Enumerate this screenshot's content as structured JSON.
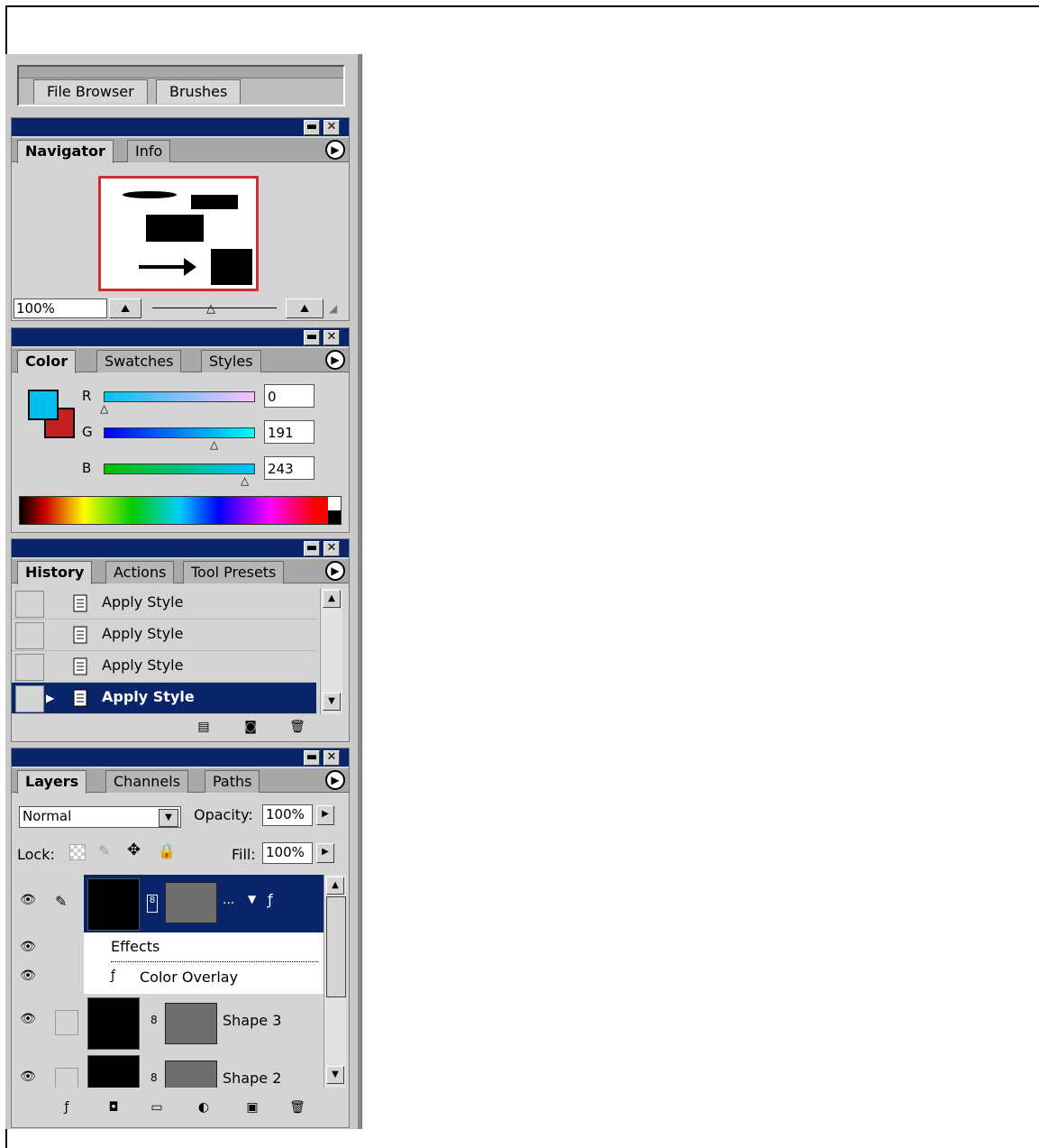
{
  "palette_well": {
    "tabs": [
      "File Browser",
      "Brushes"
    ]
  },
  "navigator": {
    "tabs": [
      "Navigator",
      "Info"
    ],
    "zoom": "100%"
  },
  "color": {
    "tabs": [
      "Color",
      "Swatches",
      "Styles"
    ],
    "channels": [
      {
        "label": "R",
        "value": "0"
      },
      {
        "label": "G",
        "value": "191"
      },
      {
        "label": "B",
        "value": "243"
      }
    ],
    "foreground": "#00bff3",
    "background": "#c42020"
  },
  "history": {
    "tabs": [
      "History",
      "Actions",
      "Tool Presets"
    ],
    "items": [
      "Apply Style",
      "Apply Style",
      "Apply Style",
      "Apply Style"
    ],
    "selected_index": 3
  },
  "layers": {
    "tabs": [
      "Layers",
      "Channels",
      "Paths"
    ],
    "blend_mode": "Normal",
    "opacity_label": "Opacity:",
    "opacity": "100%",
    "lock_label": "Lock:",
    "fill_label": "Fill:",
    "fill": "100%",
    "top_layer_suffix": "...",
    "effects_label": "Effects",
    "effect_item": "Color Overlay",
    "layer_names": [
      "Shape 3",
      "Shape 2"
    ]
  },
  "colors": {
    "titlebar": "#0a246a",
    "selection": "#0a246a",
    "panel": "#d4d4d4"
  }
}
